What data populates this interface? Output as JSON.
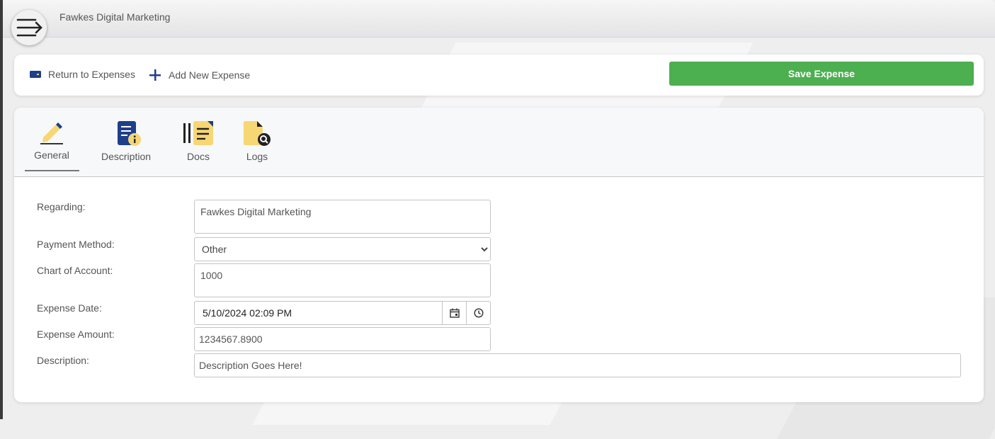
{
  "app": {
    "title": "Fawkes Digital Marketing"
  },
  "toolbar": {
    "return_label": "Return to Expenses",
    "add_label": "Add New Expense",
    "save_label": "Save Expense"
  },
  "tabs": [
    {
      "label": "General",
      "icon": "pencil-icon",
      "active": true
    },
    {
      "label": "Description",
      "icon": "document-info-icon",
      "active": false
    },
    {
      "label": "Docs",
      "icon": "docs-icon",
      "active": false
    },
    {
      "label": "Logs",
      "icon": "file-search-icon",
      "active": false
    }
  ],
  "form": {
    "regarding": {
      "label": "Regarding:",
      "value": "Fawkes Digital Marketing"
    },
    "payment_method": {
      "label": "Payment Method:",
      "value": "Other"
    },
    "chart_of_account": {
      "label": "Chart of Account:",
      "value": "1000"
    },
    "expense_date": {
      "label": "Expense Date:",
      "value": "5/10/2024 02:09 PM"
    },
    "expense_amount": {
      "label": "Expense Amount:",
      "value": "1234567.8900"
    },
    "description": {
      "label": "Description:",
      "value": "Description Goes Here!"
    }
  },
  "colors": {
    "save_button": "#4caf50",
    "brand_blue": "#1e3f8a",
    "accent_yellow": "#f7d774"
  }
}
